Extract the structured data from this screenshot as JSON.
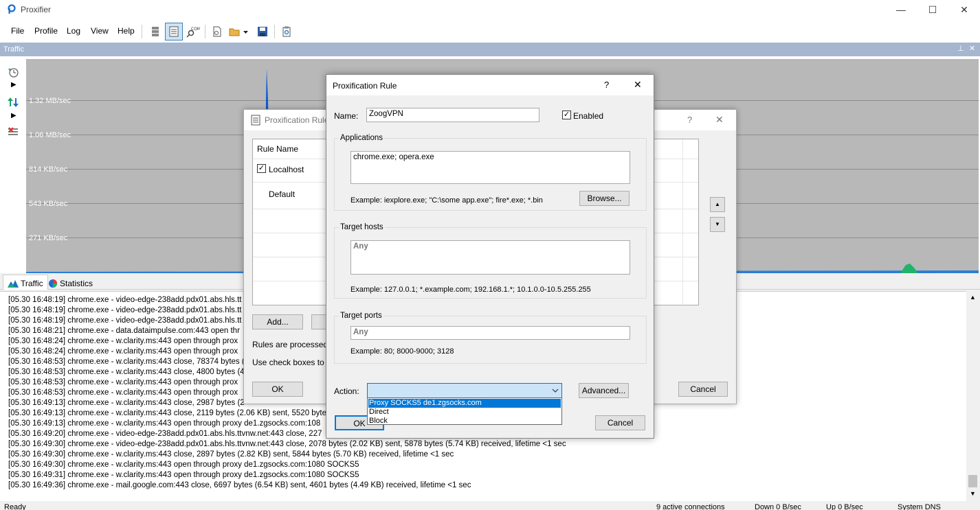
{
  "window": {
    "title": "Proxifier",
    "minimize": "—",
    "maximize": "☐",
    "close": "✕"
  },
  "menu": [
    "File",
    "Profile",
    "Log",
    "View",
    "Help"
  ],
  "toolbar": {
    "icons": [
      "proxy-servers-icon",
      "proxification-rules-icon",
      "name-resolution-icon",
      "new-profile-icon",
      "open-profile-icon",
      "save-profile-icon",
      "advanced-icon"
    ]
  },
  "traffic": {
    "title": "Traffic",
    "grid_labels": [
      "1.32 MB/sec",
      "1.06 MB/sec",
      "814 KB/sec",
      "543 KB/sec",
      "271 KB/sec"
    ],
    "colors": {
      "graph_bg": "#b8b8b8",
      "download": "#0a5bd6",
      "upload": "#1fb36b"
    }
  },
  "tabs": {
    "traffic": "Traffic",
    "statistics": "Statistics"
  },
  "log": [
    "[05.30 16:48:19] chrome.exe - video-edge-238add.pdx01.abs.hls.tt",
    "[05.30 16:48:19] chrome.exe - video-edge-238add.pdx01.abs.hls.tt",
    "[05.30 16:48:19] chrome.exe - video-edge-238add.pdx01.abs.hls.tt",
    "[05.30 16:48:21] chrome.exe - data.dataimpulse.com:443 open thr",
    "[05.30 16:48:24] chrome.exe - w.clarity.ms:443 open through prox",
    "[05.30 16:48:24] chrome.exe - w.clarity.ms:443 open through prox",
    "[05.30 16:48:53] chrome.exe - w.clarity.ms:443 close, 78374 bytes (",
    "[05.30 16:48:53] chrome.exe - w.clarity.ms:443 close, 4800 bytes (4",
    "[05.30 16:48:53] chrome.exe - w.clarity.ms:443 open through prox",
    "[05.30 16:48:53] chrome.exe - w.clarity.ms:443 open through prox",
    "[05.30 16:49:13] chrome.exe - w.clarity.ms:443 close, 2987 bytes (2",
    "[05.30 16:49:13] chrome.exe - w.clarity.ms:443 close, 2119 bytes (2.06 KB) sent, 5520 bytes",
    "[05.30 16:49:13] chrome.exe - w.clarity.ms:443 open through proxy de1.zgsocks.com:108",
    "[05.30 16:49:20] chrome.exe - video-edge-238add.pdx01.abs.hls.ttvnw.net:443 close, 227",
    "[05.30 16:49:30] chrome.exe - video-edge-238add.pdx01.abs.hls.ttvnw.net:443 close, 2078 bytes (2.02 KB) sent, 5878 bytes (5.74 KB) received, lifetime <1 sec",
    "[05.30 16:49:30] chrome.exe - w.clarity.ms:443 close, 2897 bytes (2.82 KB) sent, 5844 bytes (5.70 KB) received, lifetime <1 sec",
    "[05.30 16:49:30] chrome.exe - w.clarity.ms:443 open through proxy de1.zgsocks.com:1080 SOCKS5",
    "[05.30 16:49:31] chrome.exe - w.clarity.ms:443 open through proxy de1.zgsocks.com:1080 SOCKS5",
    "[05.30 16:49:36] chrome.exe - mail.google.com:443 close, 6697 bytes (6.54 KB) sent, 4601 bytes (4.49 KB) received, lifetime <1 sec"
  ],
  "status": {
    "ready": "Ready",
    "connections": "9 active connections",
    "down": "Down 0 B/sec",
    "up": "Up 0 B/sec",
    "dns": "System DNS"
  },
  "rules_dialog": {
    "title": "Proxification Rule",
    "help": "?",
    "close": "✕",
    "column_rule_name": "Rule Name",
    "rules": [
      {
        "name": "Localhost",
        "checked": true
      },
      {
        "name": "Default",
        "checked": false
      }
    ],
    "add_button": "Add...",
    "info_1": "Rules are processed fr",
    "info_2": "Use check boxes to en",
    "ok_button": "OK",
    "cancel_button": "Cancel",
    "up_arrow": "▲",
    "down_arrow": "▼"
  },
  "rule_dialog": {
    "title": "Proxification Rule",
    "help": "?",
    "close": "✕",
    "name_label": "Name:",
    "name_value": "ZoogVPN",
    "enabled_label": "Enabled",
    "enabled": true,
    "applications_label": "Applications",
    "applications_value": "chrome.exe; opera.exe",
    "applications_example": "Example: iexplore.exe; \"C:\\some app.exe\"; fire*.exe; *.bin",
    "browse_button": "Browse...",
    "target_hosts_label": "Target hosts",
    "target_hosts_placeholder": "Any",
    "target_hosts_example": "Example: 127.0.0.1; *.example.com; 192.168.1.*; 10.1.0.0-10.5.255.255",
    "target_ports_label": "Target ports",
    "target_ports_placeholder": "Any",
    "target_ports_example": "Example: 80; 8000-9000; 3128",
    "action_label": "Action:",
    "action_value": "",
    "action_options": [
      "Proxy SOCKS5 de1.zgsocks.com",
      "Direct",
      "Block"
    ],
    "action_selected_index": 0,
    "advanced_button": "Advanced...",
    "ok_button": "OK",
    "cancel_button": "Cancel"
  }
}
